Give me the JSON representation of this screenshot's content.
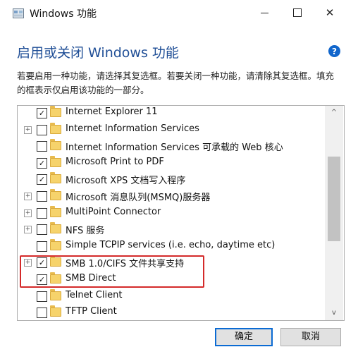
{
  "window": {
    "title": "Windows 功能"
  },
  "controls": {
    "minimize_icon": "minimize-icon",
    "maximize_icon": "maximize-icon",
    "close_glyph": "✕"
  },
  "header": {
    "heading": "启用或关闭 Windows 功能",
    "help_glyph": "?",
    "description": "若要启用一种功能，请选择其复选框。若要关闭一种功能，请清除其复选框。填充的框表示仅启用该功能的一部分。"
  },
  "features": [
    {
      "label": "Internet Explorer 11",
      "checked": true,
      "expandable": false
    },
    {
      "label": "Internet Information Services",
      "checked": false,
      "expandable": true
    },
    {
      "label": "Internet Information Services 可承载的 Web 核心",
      "checked": false,
      "expandable": false
    },
    {
      "label": "Microsoft Print to PDF",
      "checked": true,
      "expandable": false
    },
    {
      "label": "Microsoft XPS 文档写入程序",
      "checked": true,
      "expandable": false
    },
    {
      "label": "Microsoft 消息队列(MSMQ)服务器",
      "checked": false,
      "expandable": true
    },
    {
      "label": "MultiPoint Connector",
      "checked": false,
      "expandable": true
    },
    {
      "label": "NFS 服务",
      "checked": false,
      "expandable": true
    },
    {
      "label": "Simple TCPIP services (i.e. echo, daytime etc)",
      "checked": false,
      "expandable": false
    },
    {
      "label": "SMB 1.0/CIFS 文件共享支持",
      "checked": true,
      "expandable": true
    },
    {
      "label": "SMB Direct",
      "checked": true,
      "expandable": false
    },
    {
      "label": "Telnet Client",
      "checked": false,
      "expandable": false
    },
    {
      "label": "TFTP Client",
      "checked": false,
      "expandable": false
    }
  ],
  "scrollbar": {
    "up_glyph": "^",
    "down_glyph": "v"
  },
  "buttons": {
    "ok": "确定",
    "cancel": "取消"
  },
  "colors": {
    "heading": "#1f4e96",
    "highlight": "#d42a2a",
    "help": "#1166cc"
  }
}
